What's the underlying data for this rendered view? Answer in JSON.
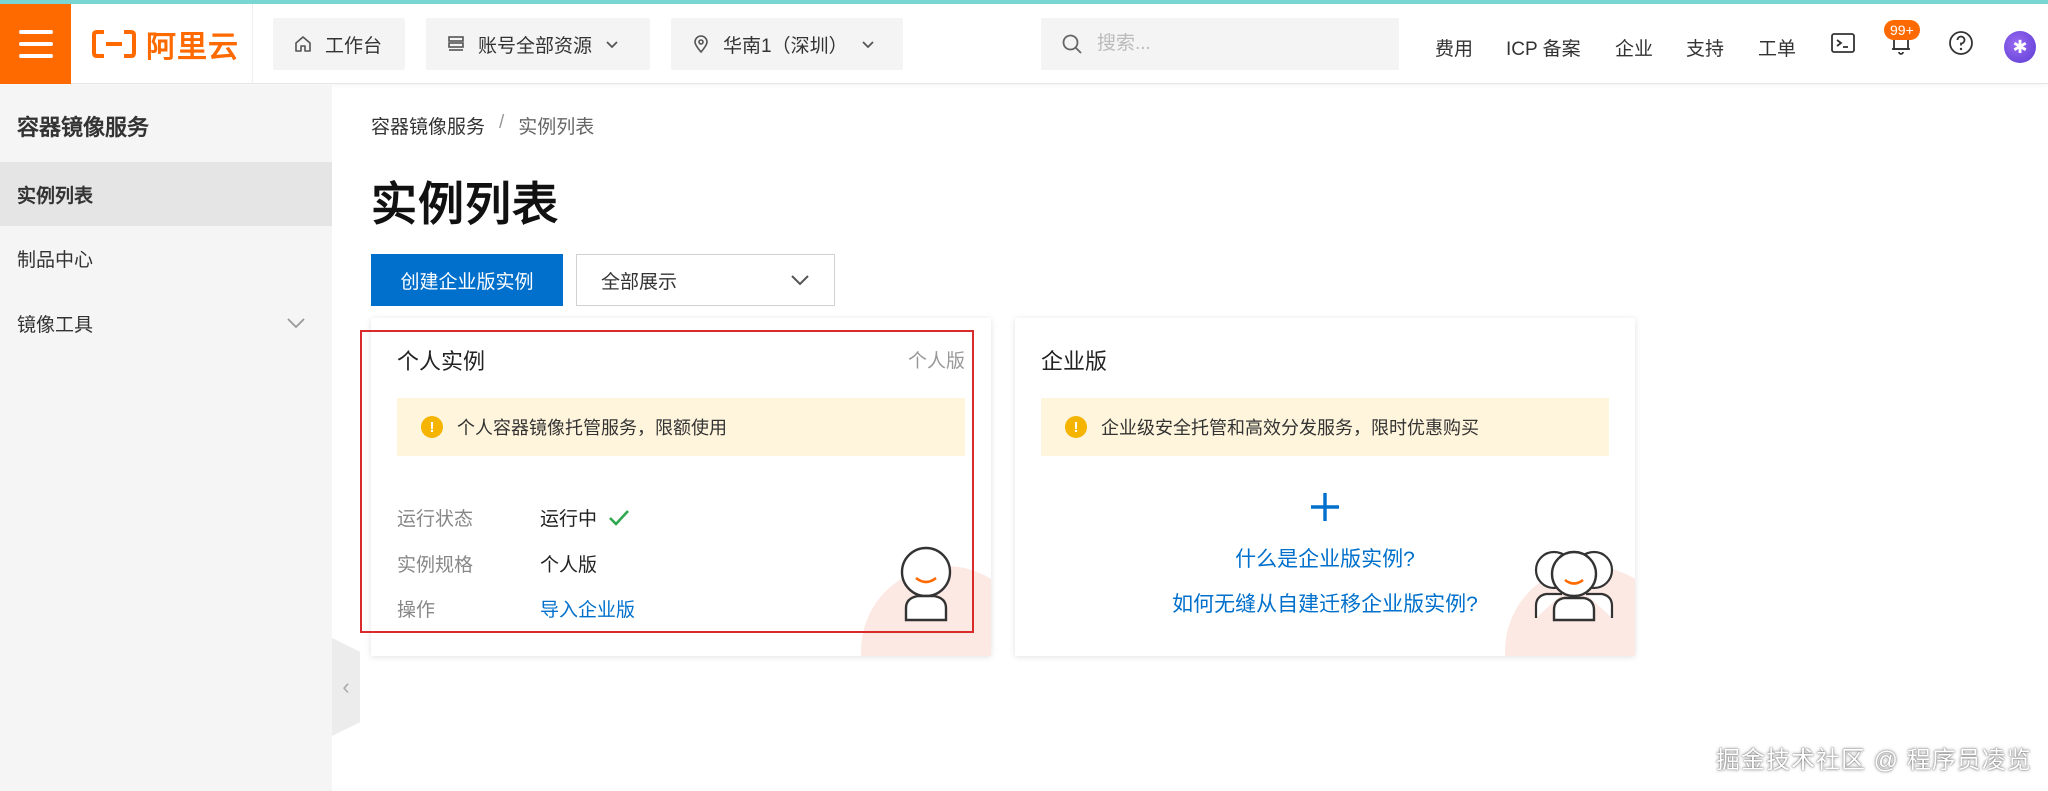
{
  "header": {
    "logo_text": "阿里云",
    "workbench": "工作台",
    "resource_scope": "账号全部资源",
    "region": "华南1（深圳）",
    "search_placeholder": "搜索...",
    "links": [
      "费用",
      "ICP 备案",
      "企业",
      "支持",
      "工单"
    ],
    "notification_badge": "99+",
    "icons": [
      "menu-icon",
      "home-icon",
      "resource-icon",
      "location-icon",
      "search-icon",
      "terminal-icon",
      "bell-icon",
      "help-icon",
      "avatar"
    ]
  },
  "sidebar": {
    "title": "容器镜像服务",
    "items": [
      {
        "label": "实例列表",
        "active": true
      },
      {
        "label": "制品中心",
        "active": false
      },
      {
        "label": "镜像工具",
        "active": false,
        "expandable": true
      }
    ]
  },
  "breadcrumb": {
    "root": "容器镜像服务",
    "separator": "/",
    "current": "实例列表"
  },
  "page": {
    "title": "实例列表",
    "create_button": "创建企业版实例",
    "filter_value": "全部展示"
  },
  "personal_card": {
    "title": "个人实例",
    "tag": "个人版",
    "notice": "个人容器镜像托管服务，限额使用",
    "status_label": "运行状态",
    "status_value": "运行中",
    "spec_label": "实例规格",
    "spec_value": "个人版",
    "action_label": "操作",
    "action_link": "导入企业版"
  },
  "enterprise_card": {
    "title": "企业版",
    "notice": "企业级安全托管和高效分发服务，限时优惠购买",
    "link_1": "什么是企业版实例?",
    "link_2": "如何无缝从自建迁移企业版实例?"
  },
  "watermark": "掘金技术社区 @ 程序员凌览",
  "colors": {
    "brand": "#ff6a00",
    "primary": "#0070cc",
    "notice_bg": "#fff5dc",
    "warning": "#f4b400",
    "success": "#2fa84f",
    "highlight": "#d92b2b"
  }
}
